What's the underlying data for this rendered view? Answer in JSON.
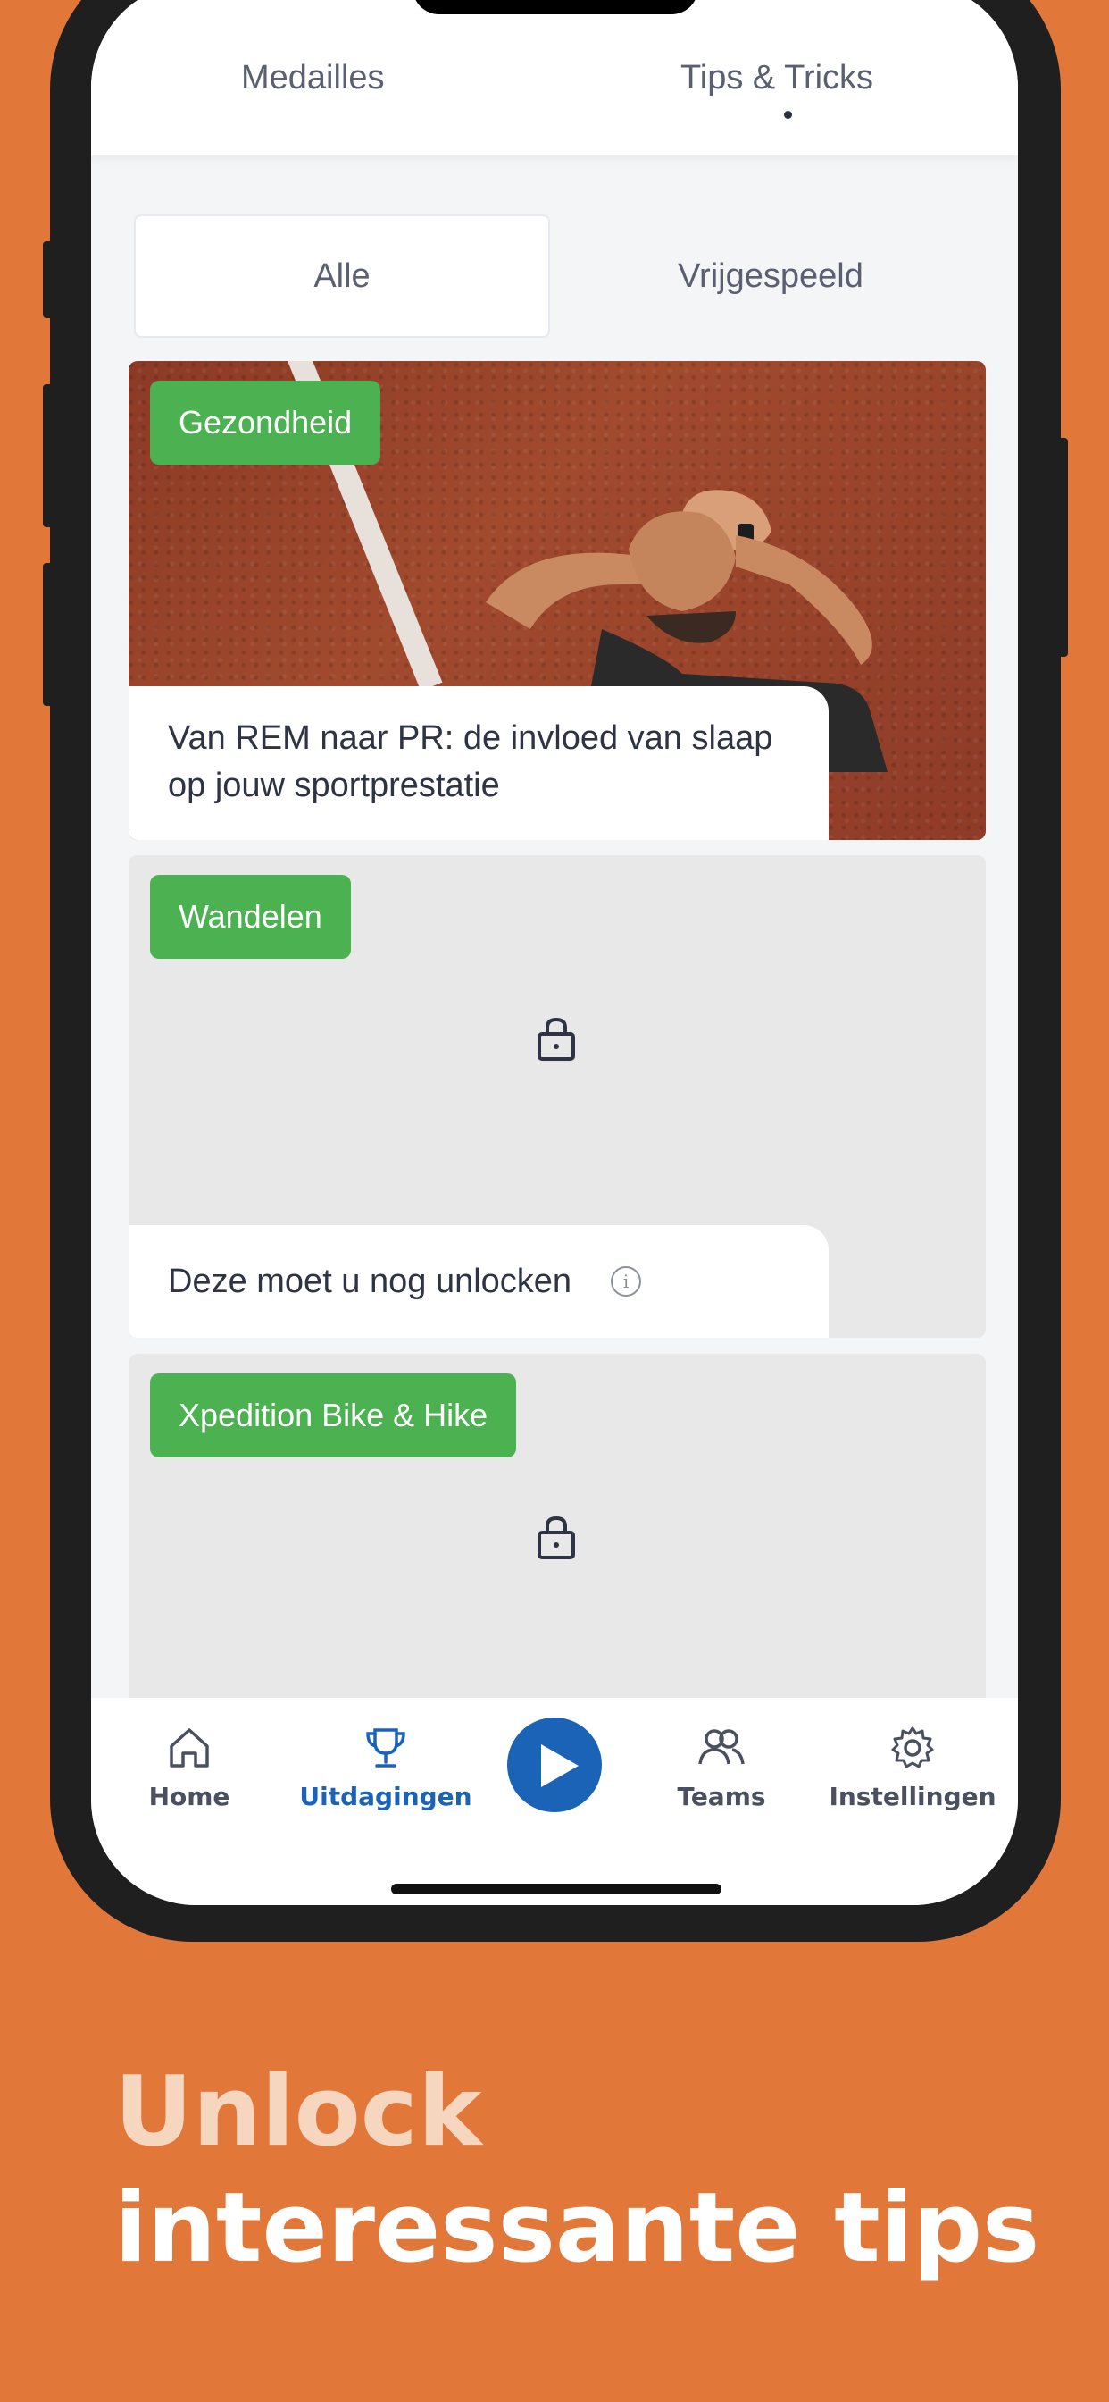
{
  "top_tabs": {
    "medailles": "Medailles",
    "tips_tricks": "Tips & Tricks"
  },
  "filter": {
    "all": "Alle",
    "unlocked": "Vrijgespeeld"
  },
  "cards": [
    {
      "tag": "Gezondheid",
      "caption": "Van REM naar PR: de invloed van slaap op jouw sportprestatie",
      "locked": false
    },
    {
      "tag": "Wandelen",
      "caption": "Deze moet u nog unlocken",
      "locked": true
    },
    {
      "tag": "Xpedition Bike & Hike",
      "caption": "",
      "locked": true
    }
  ],
  "nav": {
    "home": "Home",
    "challenges": "Uitdagingen",
    "teams": "Teams",
    "settings": "Instellingen"
  },
  "marketing": {
    "line1": "Unlock",
    "line2": "interessante tips"
  },
  "colors": {
    "background": "#E2773A",
    "tag_green": "#4CB150",
    "accent_blue": "#1A63B7"
  }
}
